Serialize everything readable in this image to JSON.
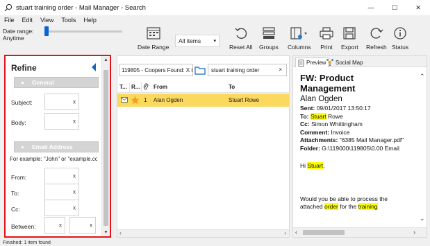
{
  "window": {
    "title": "stuart training order - Mail Manager - Search",
    "controls": {
      "minimize": "—",
      "maximize": "☐",
      "close": "✕"
    }
  },
  "menu": [
    "File",
    "Edit",
    "View",
    "Tools",
    "Help"
  ],
  "toolbar": {
    "date_range_label": "Date range:",
    "date_range_value": "Anytime",
    "date_range_button": "Date Range",
    "items_select": "All items",
    "reset_all": "Reset All",
    "groups": "Groups",
    "columns": "Columns",
    "print": "Print",
    "export": "Export",
    "refresh": "Refresh",
    "status": "Status"
  },
  "refine": {
    "title": "Refine",
    "general_header": "General",
    "subject_label": "Subject:",
    "body_label": "Body:",
    "email_header": "Email Address",
    "example": "For example: \"John\" or \"example.co",
    "from_label": "From:",
    "to_label": "To:",
    "cc_label": "Cc:",
    "between_label": "Between:",
    "clear": "x"
  },
  "list": {
    "folder": "119805 - Coopers Found: X i",
    "search_value": "stuart training order",
    "search_clear": "×",
    "columns": {
      "type": "T...",
      "rating": "R...",
      "from": "From",
      "to": "To"
    },
    "rows": [
      {
        "count": "1",
        "from": "Alan Ogden",
        "to": "Stuart Rowe"
      }
    ]
  },
  "preview": {
    "tabs": [
      "Preview",
      "Social Map"
    ],
    "subject": "FW: Product Management",
    "sender": "Alan Ogden",
    "sent_label": "Sent:",
    "sent_value": "09/01/2017 13:50:17",
    "to_label": "To:",
    "to_highlight": "Stuart",
    "to_rest": " Rowe",
    "cc_label": "Cc:",
    "cc_value": "Simon Whittingham",
    "comment_label": "Comment:",
    "comment_value": "Invoice",
    "attachments_label": "Attachments:",
    "attachments_value": "\"6385 Mail Manager.pdf\"",
    "folder_label": "Folder:",
    "folder_value": "G:\\119000\\119805\\0.00 Email",
    "greeting_pre": "Hi ",
    "greeting_name": "Stuart",
    "greeting_post": ",",
    "body_1": "Would you be able to process the attached ",
    "body_hl1": "order",
    "body_2": " for the ",
    "body_hl2": "training"
  },
  "status_bar": "Finished: 1 item found"
}
